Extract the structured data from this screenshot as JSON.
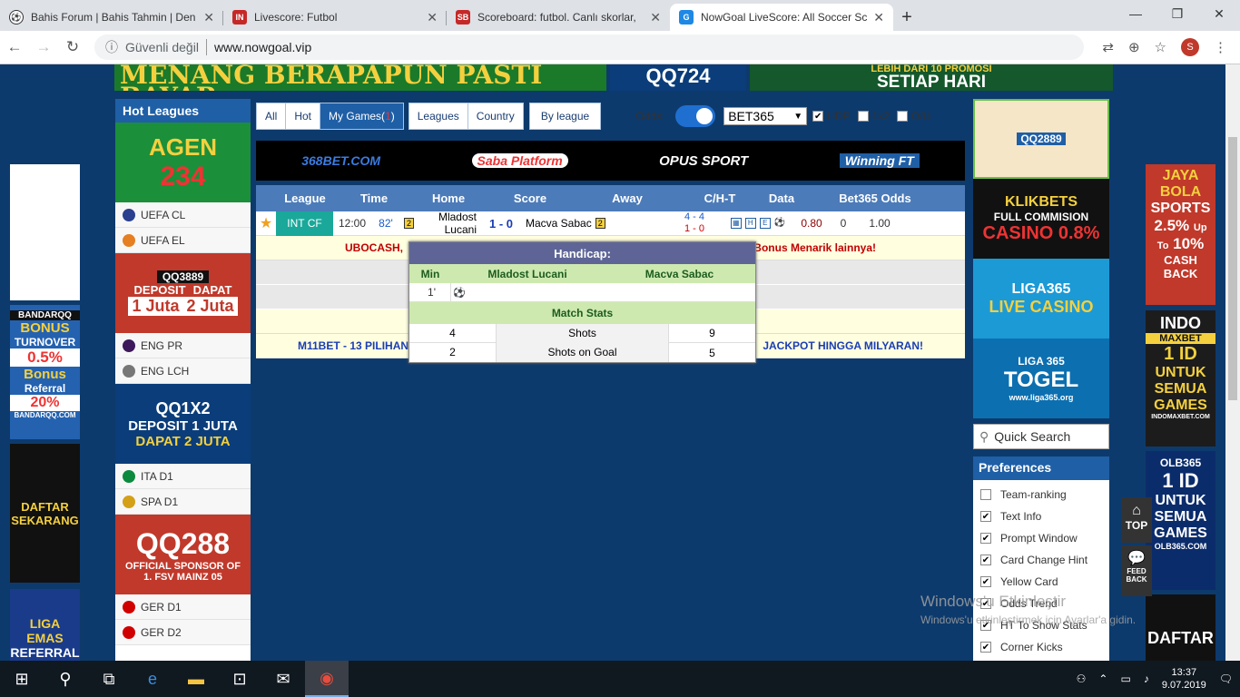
{
  "browser": {
    "tabs": [
      {
        "title": "Bahis Forum | Bahis Tahmin | Den",
        "favicon": "soccer-ball-icon",
        "active": false
      },
      {
        "title": "Livescore: Futbol",
        "favicon": "livescore-in-icon",
        "active": false
      },
      {
        "title": "Scoreboard: futbol. Canlı skorlar,",
        "favicon": "sb-icon",
        "active": false
      },
      {
        "title": "NowGoal LiveScore: All Soccer Sc",
        "favicon": "nowgoal-icon",
        "active": true
      }
    ],
    "security": "Güvenli değil",
    "url": "www.nowgoal.vip",
    "profile_initial": "S"
  },
  "ads": {
    "top_left": "MENANG BERAPAPUN PASTI BAYAR",
    "top_mid": "QQ724",
    "top_right": "SETIAP HARI",
    "top_right_partial": "LEBIH DARI 10 PROMOSI",
    "left_side": [
      "BANDARQQ",
      "BONUS",
      "TURNOVER",
      "0.5%",
      "Bonus",
      "Referral",
      "20%",
      "BANDARQQ.COM",
      "DAFTAR",
      "SEKARANG",
      "LIGA EMAS",
      "REFERRAL"
    ],
    "right_side": [
      "JAYA",
      "BOLA",
      "SPORTS",
      "2.5%",
      "Up",
      "To",
      "10%",
      "CASH",
      "BACK",
      "INDO",
      "MAXBET",
      "1 ID",
      "UNTUK",
      "SEMUA",
      "GAMES",
      "INDOMAXBET.COM",
      "OLB365",
      "1 ID",
      "UNTUK",
      "SEMUA",
      "GAMES",
      "OLB365.COM",
      "DAFTAR"
    ],
    "left_col": [
      "AGEN",
      "234",
      "QQ3889",
      "DEPOSIT",
      "1 Juta",
      "DAPAT",
      "2 Juta",
      "QQ1X2",
      "DEPOSIT 1 JUTA",
      "DAPAT 2 JUTA",
      "QQ288",
      "OFFICIAL SPONSOR OF",
      "1. FSV MAINZ 05"
    ],
    "right_col": [
      "QQ2889",
      "KLIKBETS",
      "FULL COMMISION",
      "CASINO 0.8%",
      "LIGA365",
      "LIVE CASINO",
      "LIGA 365",
      "TOGEL",
      "www.liga365.org"
    ]
  },
  "hot_leagues": {
    "title": "Hot Leagues",
    "items": [
      "UEFA CL",
      "UEFA EL",
      "ENG PR",
      "ENG LCH",
      "ITA D1",
      "SPA D1",
      "GER D1",
      "GER D2"
    ]
  },
  "filters": {
    "all": "All",
    "hot": "Hot",
    "my_games": "My Games(",
    "my_games_count": "1",
    "my_games_close": ")",
    "leagues": "Leagues",
    "country": "Country",
    "by_league": "By league",
    "odds_label": "Odds:",
    "bookmaker": "BET365",
    "hdp": "HDP",
    "x12": "1x2",
    "ou": "O/U"
  },
  "sponsors": [
    "368BET.COM",
    "Saba Platform",
    "OPUS SPORT",
    "Winning FT"
  ],
  "table": {
    "headers": [
      "League",
      "Time",
      "Home",
      "Score",
      "Away",
      "C/H-T",
      "Data",
      "Bet365 Odds"
    ],
    "match": {
      "league": "INT CF",
      "time": "12:00",
      "minute": "82'",
      "home": "Mladost Lucani",
      "home_card": "2",
      "score": "1 - 0",
      "away": "Macva Sabac",
      "away_card": "2",
      "corners": "4 - 4",
      "half_time": "1 - 0",
      "odds": [
        "0.80",
        "0",
        "1.00"
      ]
    },
    "ann_red_left": "UBOCASH,",
    "ann_red_right": "Bonus Menarik lainnya!",
    "ann_blue_left": "M11BET - 13 PILIHAN",
    "ann_blue_right": "JACKPOT HINGGA MILYARAN!"
  },
  "popup": {
    "title": "Handicap:",
    "cols": [
      "Min",
      "Mladost Lucani",
      "Macva Sabac"
    ],
    "event_min": "1'",
    "section": "Match Stats",
    "stats": [
      {
        "home": "4",
        "label": "Shots",
        "away": "9"
      },
      {
        "home": "2",
        "label": "Shots on Goal",
        "away": "5"
      }
    ]
  },
  "search": {
    "label": "Quick Search"
  },
  "preferences": {
    "title": "Preferences",
    "items": [
      {
        "label": "Team-ranking",
        "checked": false
      },
      {
        "label": "Text Info",
        "checked": true
      },
      {
        "label": "Prompt Window",
        "checked": true
      },
      {
        "label": "Card Change Hint",
        "checked": true
      },
      {
        "label": "Yellow Card",
        "checked": true
      },
      {
        "label": "Odds Trend",
        "checked": true
      },
      {
        "label": "HT To Show Stats",
        "checked": true
      },
      {
        "label": "Corner Kicks",
        "checked": true
      }
    ]
  },
  "floating": {
    "top": "TOP",
    "feedback1": "FEED",
    "feedback2": "BACK"
  },
  "watermark": {
    "line1": "Windows'u Etkinleştir",
    "line2": "Windows'u etkinleştirmek için Ayarlar'a gidin."
  },
  "taskbar": {
    "time": "13:37",
    "date": "9.07.2019"
  },
  "colors": {
    "header_blue": "#1f5fa6",
    "table_head": "#4c7bb9",
    "league_teal": "#19a89a",
    "popup_title": "#5e6596",
    "popup_green": "#cde9b0"
  }
}
